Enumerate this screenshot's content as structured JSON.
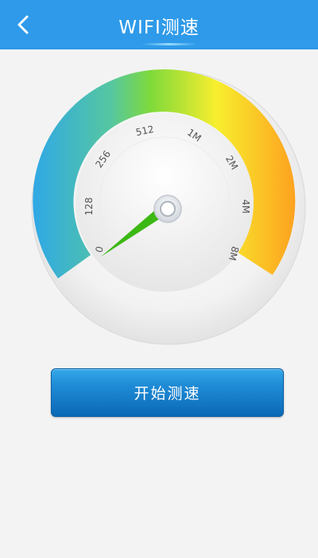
{
  "header": {
    "title": "WIFI测速",
    "back_icon": "chevron-left-icon",
    "background": "#2e9ae9"
  },
  "gauge": {
    "scale_labels": [
      "0",
      "128",
      "256",
      "512",
      "1M",
      "2M",
      "4M",
      "8M"
    ],
    "needle_value": "0",
    "needle_color": "#3cb814",
    "arc_colors": [
      "#2fa8e6",
      "#7fda3a",
      "#f8ee2e",
      "#fda21f"
    ]
  },
  "action": {
    "start_label": "开始测速",
    "button_color": "#1a84d0"
  }
}
